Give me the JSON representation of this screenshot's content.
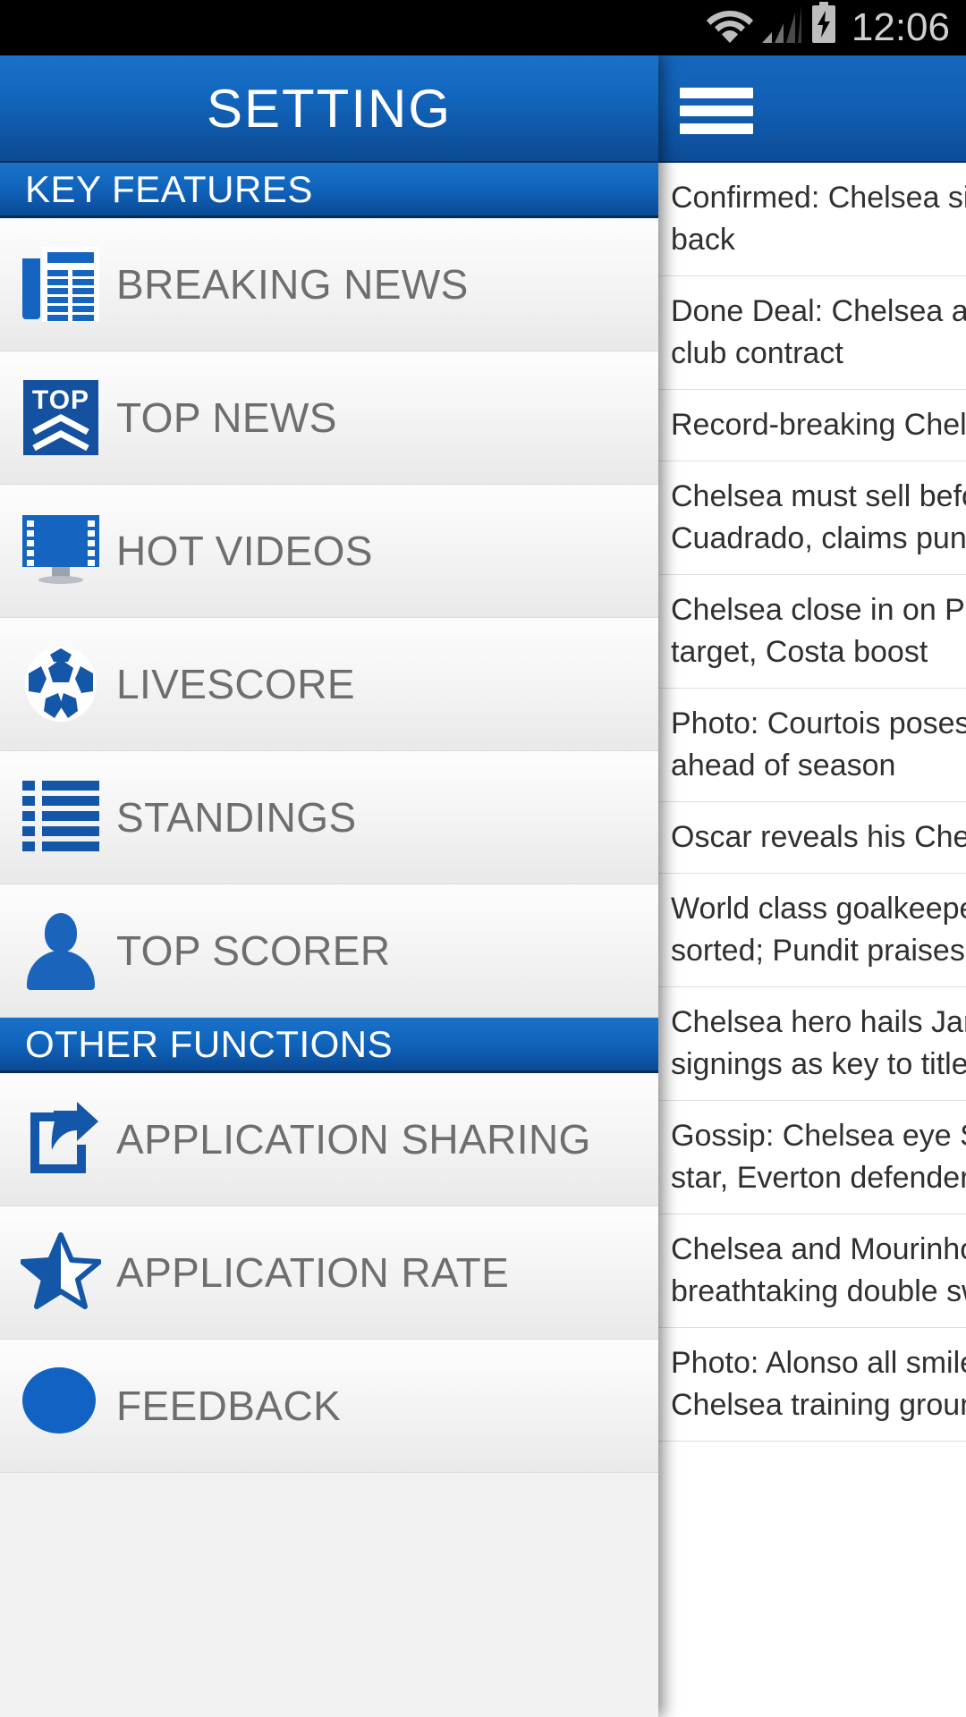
{
  "statusbar": {
    "time": "12:06",
    "icons": [
      "wifi-icon",
      "cellular-signal-icon",
      "battery-charging-icon"
    ]
  },
  "underlying_screen": {
    "appbar": {},
    "news_headlines": [
      "Confirmed: Chelsea sign new left",
      "back",
      "Done Deal: Chelsea agree five-year",
      "club contract",
      "Record-breaking Chelsea star rated",
      "Chelsea must sell before signing",
      "Cuadrado, claims pundit",
      "Chelsea close in on Premier League",
      "target, Costa boost",
      "Photo: Courtois poses with trophy",
      "ahead of season",
      "Oscar reveals his Chelsea ambition",
      "World class goalkeeper hunt",
      "sorted; Pundit praises Blues",
      "Chelsea hero hails January",
      "signings as key to title bid",
      "Gossip: Chelsea eye Serie A",
      "star, Everton defender linked",
      "Chelsea and Mourinho plot",
      "breathtaking double swoop",
      "Photo: Alonso all smiles at",
      "Chelsea training ground"
    ]
  },
  "drawer": {
    "title": "SETTING",
    "menu_icon": "hamburger-menu-icon",
    "sections": [
      {
        "header": "KEY FEATURES",
        "items": [
          {
            "label": "BREAKING NEWS",
            "icon": "newspaper-icon"
          },
          {
            "label": "TOP NEWS",
            "icon": "top-chevrons-icon",
            "badge": "TOP"
          },
          {
            "label": "HOT VIDEOS",
            "icon": "video-monitor-icon"
          },
          {
            "label": "LIVESCORE",
            "icon": "soccer-ball-icon"
          },
          {
            "label": "STANDINGS",
            "icon": "bulleted-list-icon"
          },
          {
            "label": "TOP SCORER",
            "icon": "person-icon"
          }
        ]
      },
      {
        "header": "OTHER FUNCTIONS",
        "items": [
          {
            "label": "APPLICATION SHARING",
            "icon": "share-document-icon"
          },
          {
            "label": "APPLICATION RATE",
            "icon": "half-star-icon"
          },
          {
            "label": "FEEDBACK",
            "icon": "feedback-bubble-icon"
          }
        ]
      }
    ]
  },
  "colors": {
    "brand_blue": "#1063bb",
    "brand_blue_dark": "#0a4a95",
    "icon_blue": "#1456a8",
    "label_gray": "#6e6e6e",
    "row_bg": "#f2f2f2",
    "statusbar_bg": "#000000"
  }
}
